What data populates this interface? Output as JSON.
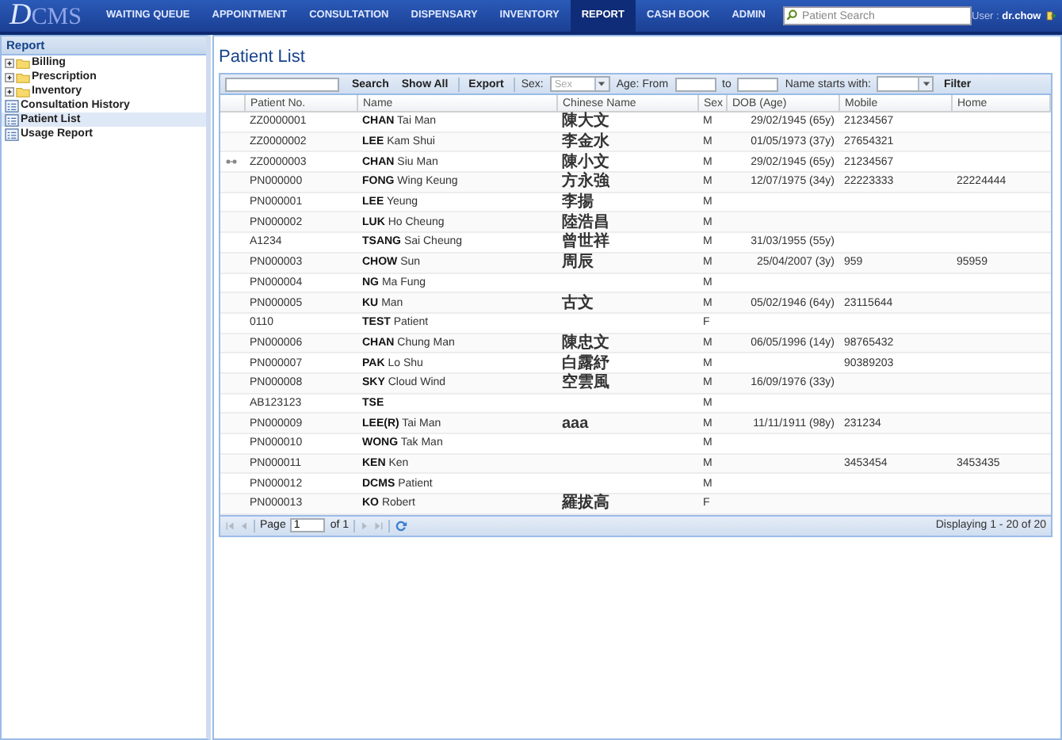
{
  "header": {
    "logo": {
      "mark": "D",
      "text": "CMS"
    },
    "nav": [
      {
        "label": "WAITING QUEUE",
        "selected": false
      },
      {
        "label": "APPOINTMENT",
        "selected": false
      },
      {
        "label": "CONSULTATION",
        "selected": false
      },
      {
        "label": "DISPENSARY",
        "selected": false
      },
      {
        "label": "INVENTORY",
        "selected": false
      },
      {
        "label": "REPORT",
        "selected": true
      },
      {
        "label": "CASH BOOK",
        "selected": false
      },
      {
        "label": "ADMIN",
        "selected": false
      }
    ],
    "search": {
      "placeholder": "Patient Search"
    },
    "user": "User : **dr.chow**"
  },
  "sidebar": {
    "title": "Report",
    "items": [
      {
        "kind": "folder",
        "label": "Billing",
        "expanded": false,
        "selected": false
      },
      {
        "kind": "folder",
        "label": "Prescription",
        "expanded": false,
        "selected": false
      },
      {
        "kind": "folder",
        "label": "Inventory",
        "expanded": false,
        "selected": false
      },
      {
        "kind": "report",
        "label": "Consultation History",
        "selected": false
      },
      {
        "kind": "report",
        "label": "Patient List",
        "selected": true
      },
      {
        "kind": "report",
        "label": "Usage Report",
        "selected": false
      }
    ]
  },
  "main": {
    "title": "Patient List",
    "toolbar": {
      "search_button": "Search",
      "show_all_button": "Show All",
      "export_button": "Export",
      "sex_label": "Sex:",
      "sex_select": {
        "placeholder": "Sex"
      },
      "age_from_label": "Age: From",
      "age_to_label": "to",
      "name_starts_label": "Name starts with:",
      "filter_button": "Filter"
    },
    "table": {
      "columns": [
        "Patient No.",
        "Name",
        "Chinese Name",
        "Sex",
        "DOB (Age)",
        "Mobile",
        "Home"
      ],
      "rows": [
        {
          "marked": false,
          "patient_no": "ZZ0000001",
          "surname": "CHAN",
          "given": "Tai Man",
          "chinese_name": "陳大文",
          "sex": "M",
          "dob": "29/02/1945 (65y)",
          "mobile": "21234567"
        },
        {
          "marked": false,
          "patient_no": "ZZ0000002",
          "surname": "LEE",
          "given": "Kam Shui",
          "chinese_name": "李金水",
          "sex": "M",
          "dob": "01/05/1973 (37y)",
          "mobile": "27654321"
        },
        {
          "marked": true,
          "patient_no": "ZZ0000003",
          "surname": "CHAN",
          "given": "Siu Man",
          "chinese_name": "陳小文",
          "sex": "M",
          "dob": "29/02/1945 (65y)",
          "mobile": "21234567"
        },
        {
          "marked": false,
          "patient_no": "PN000000",
          "surname": "FONG",
          "given": "Wing Keung",
          "chinese_name": "方永強",
          "sex": "M",
          "dob": "12/07/1975 (34y)",
          "mobile": "22223333",
          "home": "22224444"
        },
        {
          "marked": false,
          "patient_no": "PN000001",
          "surname": "LEE",
          "given": "Yeung",
          "chinese_name": "李揚",
          "sex": "M"
        },
        {
          "marked": false,
          "patient_no": "PN000002",
          "surname": "LUK",
          "given": "Ho Cheung",
          "chinese_name": "陸浩昌",
          "sex": "M"
        },
        {
          "marked": false,
          "patient_no": "A1234",
          "surname": "TSANG",
          "given": "Sai Cheung",
          "chinese_name": "曾世祥",
          "sex": "M",
          "dob": "31/03/1955 (55y)"
        },
        {
          "marked": false,
          "patient_no": "PN000003",
          "surname": "CHOW",
          "given": "Sun",
          "chinese_name": "周辰",
          "sex": "M",
          "dob": "25/04/2007 (3y)",
          "mobile": "959",
          "home": "95959"
        },
        {
          "marked": false,
          "patient_no": "PN000004",
          "surname": "NG",
          "given": "Ma Fung",
          "sex": "M"
        },
        {
          "marked": false,
          "patient_no": "PN000005",
          "surname": "KU",
          "given": "Man",
          "chinese_name": "古文",
          "sex": "M",
          "dob": "05/02/1946 (64y)",
          "mobile": "23115644"
        },
        {
          "marked": false,
          "patient_no": "0110",
          "surname": "TEST",
          "given": "Patient",
          "sex": "F"
        },
        {
          "marked": false,
          "patient_no": "PN000006",
          "surname": "CHAN",
          "given": "Chung Man",
          "chinese_name": "陳忠文",
          "sex": "M",
          "dob": "06/05/1996 (14y)",
          "mobile": "98765432"
        },
        {
          "marked": false,
          "patient_no": "PN000007",
          "surname": "PAK",
          "given": "Lo Shu",
          "chinese_name": "白露紓",
          "sex": "M",
          "mobile": "90389203"
        },
        {
          "marked": false,
          "patient_no": "PN000008",
          "surname": "SKY",
          "given": "Cloud Wind",
          "chinese_name": "空雲風",
          "sex": "M",
          "dob": "16/09/1976 (33y)"
        },
        {
          "marked": false,
          "patient_no": "AB123123",
          "surname": "TSE",
          "sex": "M"
        },
        {
          "marked": false,
          "patient_no": "PN000009",
          "surname": "LEE(R)",
          "given": "Tai Man",
          "chinese_name": "aaa",
          "sex": "M",
          "dob": "11/11/1911 (98y)",
          "mobile": "231234"
        },
        {
          "marked": false,
          "patient_no": "PN000010",
          "surname": "WONG",
          "given": "Tak Man",
          "sex": "M"
        },
        {
          "marked": false,
          "patient_no": "PN000011",
          "surname": "KEN",
          "given": "Ken",
          "sex": "M",
          "mobile": "3453454",
          "home": "3453435"
        },
        {
          "marked": false,
          "patient_no": "PN000012",
          "surname": "DCMS",
          "given": "Patient",
          "sex": "M"
        },
        {
          "marked": false,
          "patient_no": "PN000013",
          "surname": "KO",
          "given": "Robert",
          "chinese_name": "羅拔高",
          "sex": "F"
        }
      ]
    },
    "pager": {
      "page_label": "Page",
      "page": "1",
      "of_label": "of 1",
      "summary": "Displaying 1 - 20 of 20"
    }
  }
}
